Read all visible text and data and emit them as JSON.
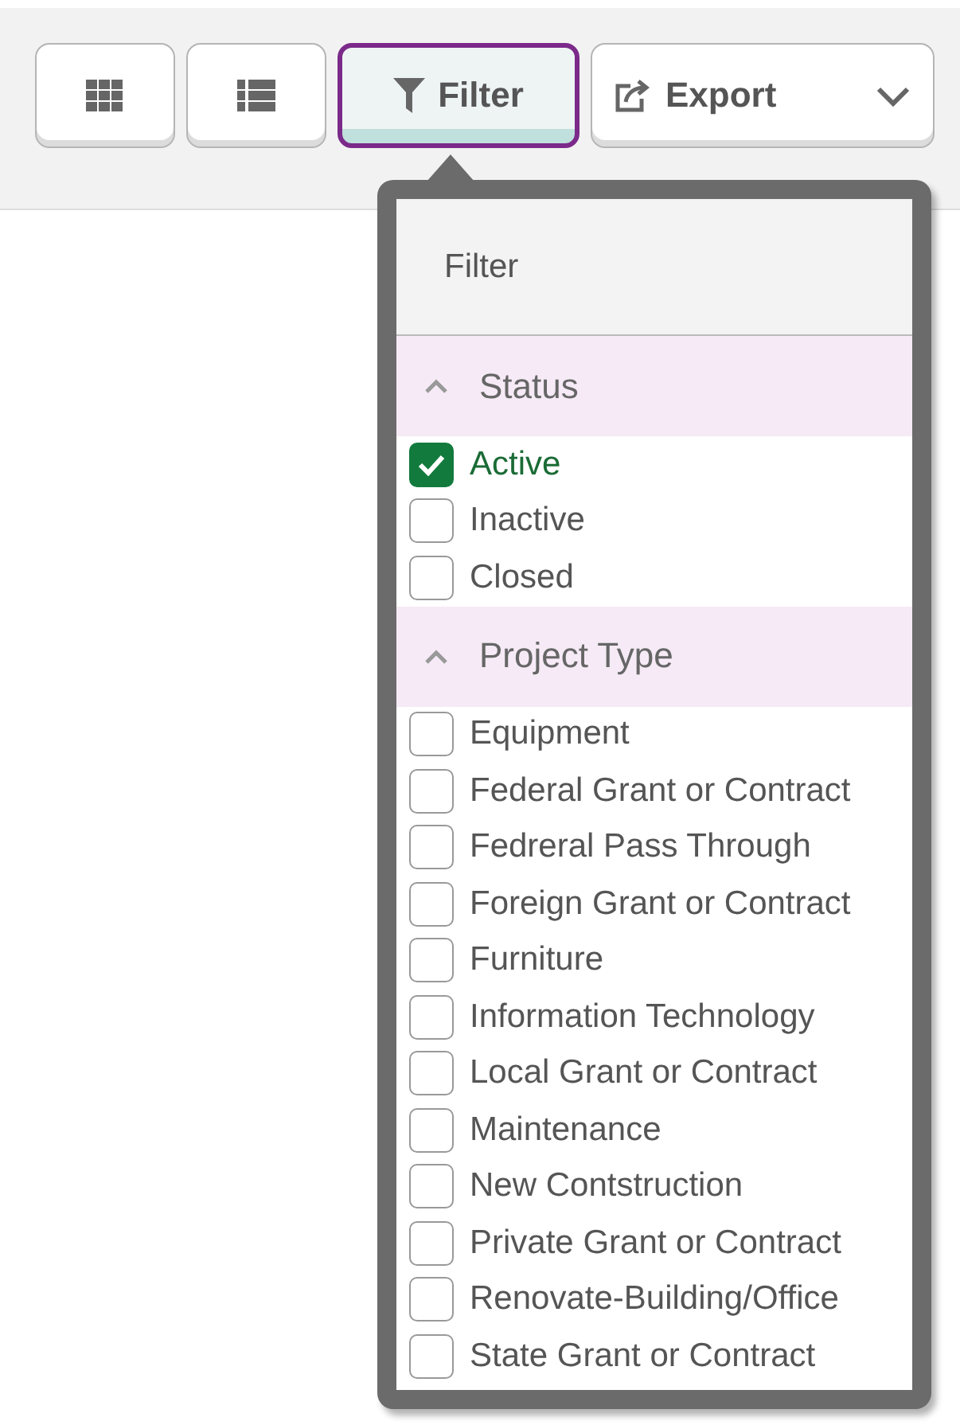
{
  "toolbar": {
    "buttons": [
      {
        "kind": "grid",
        "selected": false
      },
      {
        "kind": "list",
        "selected": false
      },
      {
        "kind": "filter",
        "label": "Filter",
        "selected": true
      },
      {
        "kind": "export",
        "label": "Export",
        "selected": false
      }
    ]
  },
  "filter_popover": {
    "title": "Filter",
    "sections": [
      {
        "title": "Status",
        "expanded": true,
        "options": [
          {
            "label": "Active",
            "checked": true
          },
          {
            "label": "Inactive",
            "checked": false
          },
          {
            "label": "Closed",
            "checked": false
          }
        ]
      },
      {
        "title": "Project Type",
        "expanded": true,
        "options": [
          {
            "label": "Equipment",
            "checked": false
          },
          {
            "label": "Federal Grant or Contract",
            "checked": false
          },
          {
            "label": "Fedreral Pass Through",
            "checked": false
          },
          {
            "label": "Foreign Grant or Contract",
            "checked": false
          },
          {
            "label": "Furniture",
            "checked": false
          },
          {
            "label": "Information Technology",
            "checked": false
          },
          {
            "label": "Local Grant or Contract",
            "checked": false
          },
          {
            "label": "Maintenance",
            "checked": false
          },
          {
            "label": "New Contstruction",
            "checked": false
          },
          {
            "label": "Private Grant or Contract",
            "checked": false
          },
          {
            "label": "Renovate-Building/Office",
            "checked": false
          },
          {
            "label": "State Grant or Contract",
            "checked": false
          }
        ]
      }
    ]
  }
}
